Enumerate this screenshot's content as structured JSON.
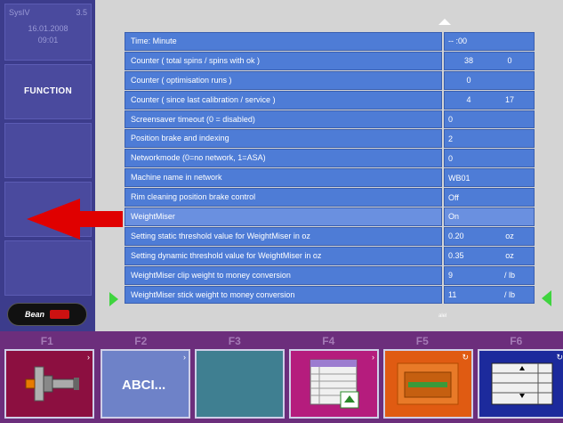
{
  "sidebar": {
    "system": "SysIV",
    "version": "3.5",
    "date": "16.01.2008",
    "time": "09:01",
    "function_label": "FUNCTION",
    "logo_text": "Bean"
  },
  "table": {
    "rows": [
      {
        "label": "Time: Minute",
        "v1": "-- :00",
        "v2": ""
      },
      {
        "label": "Counter ( total spins / spins with ok )",
        "v1": "38",
        "v2": "0"
      },
      {
        "label": "Counter ( optimisation runs )",
        "v1": "0",
        "v2": ""
      },
      {
        "label": "Counter ( since last calibration / service )",
        "v1": "4",
        "v2": "17"
      },
      {
        "label": "Screensaver timeout (0 = disabled)",
        "v1": "0",
        "v2": ""
      },
      {
        "label": "Position brake and indexing",
        "v1": "2",
        "v2": ""
      },
      {
        "label": "Networkmode (0=no network, 1=ASA)",
        "v1": "0",
        "v2": ""
      },
      {
        "label": "Machine name in network",
        "v1": "WB01",
        "v2": ""
      },
      {
        "label": "Rim cleaning position brake control",
        "v1": "Off",
        "v2": ""
      },
      {
        "label": "WeightMiser",
        "v1": "On",
        "v2": ""
      },
      {
        "label": "Setting static threshold value for WeightMiser in oz",
        "v1": "0.20",
        "v2": "oz"
      },
      {
        "label": "Setting dynamic threshold value for WeightMiser in oz",
        "v1": "0.35",
        "v2": "oz"
      },
      {
        "label": "WeightMiser clip weight to money conversion",
        "v1": "9",
        "v2": "/ lb"
      },
      {
        "label": "WeightMiser stick weight to money conversion",
        "v1": "11",
        "v2": "/ lb"
      }
    ]
  },
  "scroll_tick": "alel",
  "fkeys": {
    "labels": [
      "F1",
      "F2",
      "F3",
      "F4",
      "F5",
      "F6"
    ],
    "f2_text": "ABCI...",
    "f4_rows": [
      "1",
      "2",
      "3",
      "4",
      "5"
    ]
  },
  "colors": {
    "sidebar": "#3c3c8c",
    "table_cell": "#4e7cd6",
    "fkey_strip": "#6c2e7c",
    "pointer": "#e00000",
    "nav_arrow": "#3fd43f"
  },
  "icons": {
    "f1": "wheel-balancer-shaft-icon",
    "f4": "table-edit-icon",
    "f5": "brake-indicator-icon",
    "f6": "scroll-list-icon"
  }
}
